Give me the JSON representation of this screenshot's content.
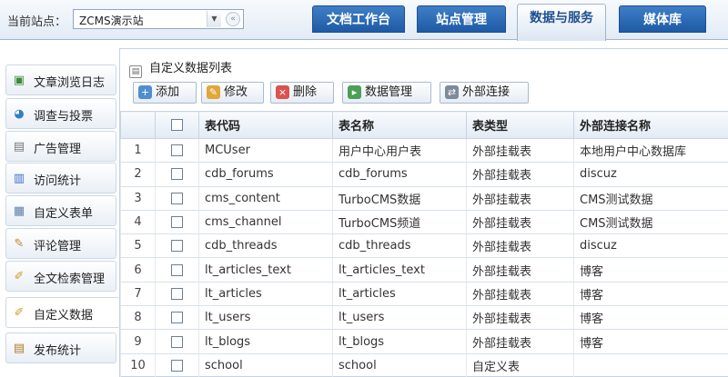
{
  "header": {
    "site_label": "当前站点：",
    "site_value": "ZCMS演示站",
    "tabs": [
      "文档工作台",
      "站点管理",
      "数据与服务",
      "媒体库"
    ],
    "active_tab": "数据与服务"
  },
  "sidebar": {
    "items": [
      {
        "label": "文章浏览日志",
        "icon": "article-log-icon"
      },
      {
        "label": "调查与投票",
        "icon": "survey-icon"
      },
      {
        "label": "广告管理",
        "icon": "ad-icon"
      },
      {
        "label": "访问统计",
        "icon": "stats-chart-icon"
      },
      {
        "label": "自定义表单",
        "icon": "form-icon"
      },
      {
        "label": "评论管理",
        "icon": "comment-icon"
      },
      {
        "label": "全文检索管理",
        "icon": "search-index-icon"
      },
      {
        "label": "自定义数据",
        "icon": "custom-data-icon"
      },
      {
        "label": "发布统计",
        "icon": "publish-stats-icon"
      }
    ],
    "active": "自定义数据"
  },
  "panel": {
    "title": "自定义数据列表",
    "toolbar": {
      "add": "添加",
      "edit": "修改",
      "delete": "删除",
      "manage": "数据管理",
      "external": "外部连接"
    }
  },
  "table": {
    "headers": [
      "",
      "",
      "表代码",
      "表名称",
      "表类型",
      "外部连接名称"
    ],
    "rows": [
      {
        "n": "1",
        "code": "MCUser",
        "name": "用户中心用户表",
        "type": "外部挂载表",
        "ext": "本地用户中心数据库"
      },
      {
        "n": "2",
        "code": "cdb_forums",
        "name": "cdb_forums",
        "type": "外部挂载表",
        "ext": "discuz"
      },
      {
        "n": "3",
        "code": "cms_content",
        "name": "TurboCMS数据",
        "type": "外部挂载表",
        "ext": "CMS测试数据"
      },
      {
        "n": "4",
        "code": "cms_channel",
        "name": "TurboCMS频道",
        "type": "外部挂载表",
        "ext": "CMS测试数据"
      },
      {
        "n": "5",
        "code": "cdb_threads",
        "name": "cdb_threads",
        "type": "外部挂载表",
        "ext": "discuz"
      },
      {
        "n": "6",
        "code": "lt_articles_text",
        "name": "lt_articles_text",
        "type": "外部挂载表",
        "ext": "博客"
      },
      {
        "n": "7",
        "code": "lt_articles",
        "name": "lt_articles",
        "type": "外部挂载表",
        "ext": "博客"
      },
      {
        "n": "8",
        "code": "lt_users",
        "name": "lt_users",
        "type": "外部挂载表",
        "ext": "博客"
      },
      {
        "n": "9",
        "code": "lt_blogs",
        "name": "lt_blogs",
        "type": "外部挂载表",
        "ext": "博客"
      },
      {
        "n": "10",
        "code": "school",
        "name": "school",
        "type": "自定义表",
        "ext": ""
      }
    ]
  },
  "colors": {
    "tab_blue": "#2a66b0",
    "tab_active_text": "#1d4f8f",
    "border": "#c5d3e2"
  }
}
